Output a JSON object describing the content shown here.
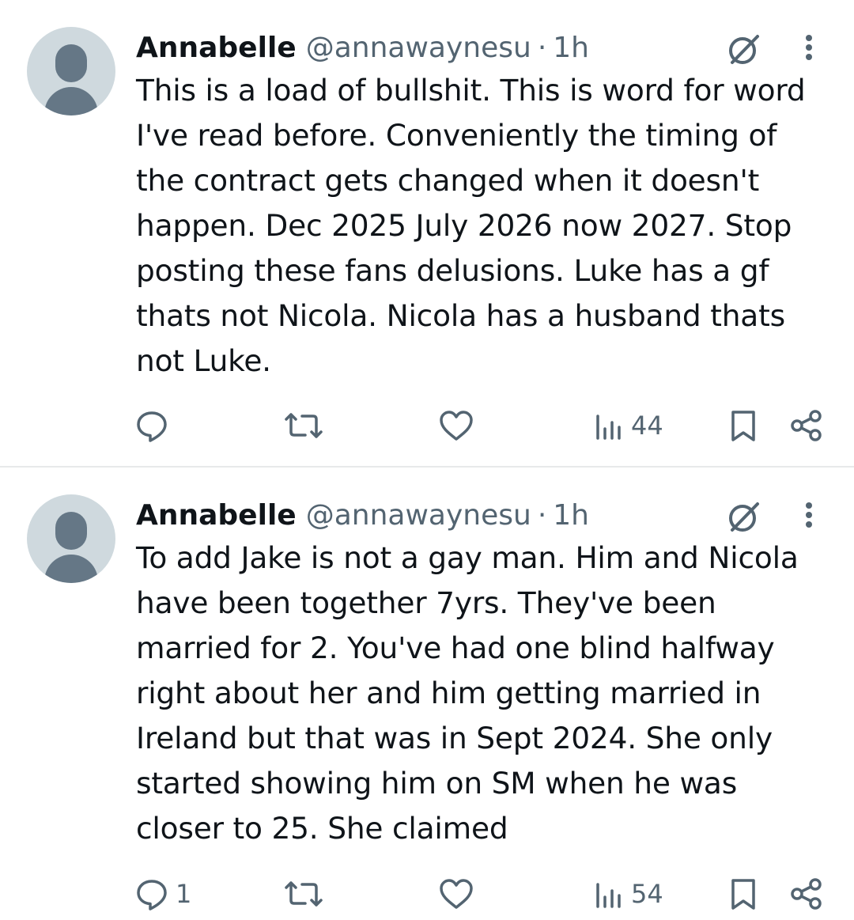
{
  "tweets": [
    {
      "display_name": "Annabelle",
      "handle": "@annawaynesu",
      "separator": "·",
      "time": "1h",
      "text": "This is a load of bullshit. This is word for word\nI've read before. Conveniently the timing of\nthe contract gets changed when it doesn't\nhappen. Dec 2025 July 2026 now 2027. Stop\nposting these fans delusions. Luke has a gf\nthats not Nicola. Nicola has a husband thats\nnot Luke.",
      "reply_count": "",
      "view_count": "44"
    },
    {
      "display_name": "Annabelle",
      "handle": "@annawaynesu",
      "separator": "·",
      "time": "1h",
      "text": "To add Jake is not a gay man. Him and Nicola\nhave been together 7yrs. They've been\nmarried for 2. You've had one blind halfway\nright about her and him getting married in\nIreland but that was in Sept 2024. She only\nstarted showing him on SM when he was\ncloser to 25. She claimed",
      "reply_count": "1",
      "view_count": "54"
    }
  ],
  "icons": {
    "avatar": "default-avatar-icon",
    "grok": "grok-icon",
    "more": "more-vertical-icon",
    "reply": "reply-icon",
    "retweet": "retweet-icon",
    "like": "heart-icon",
    "views": "views-chart-icon",
    "bookmark": "bookmark-icon",
    "share": "share-icon"
  },
  "colors": {
    "text": "#0f1419",
    "secondary": "#536471",
    "divider": "#e7e9ea",
    "avatar_bg": "#cfd9de",
    "avatar_fg": "#657786"
  }
}
